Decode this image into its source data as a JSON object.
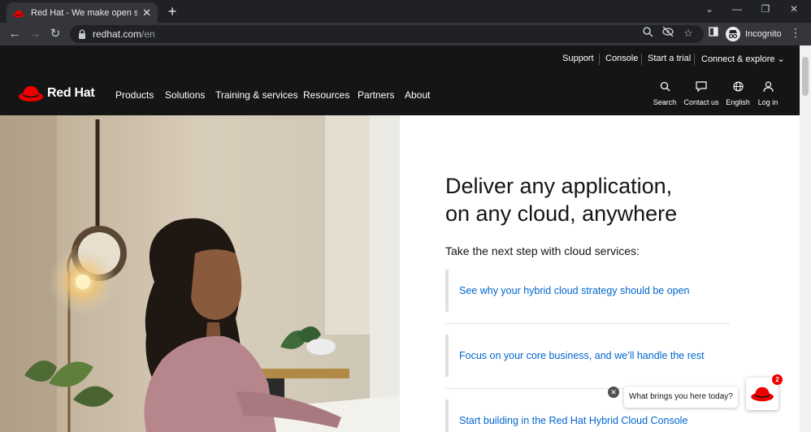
{
  "browser": {
    "tab_title": "Red Hat - We make open source",
    "tab_close": "✕",
    "new_tab": "+",
    "url_host": "redhat.com",
    "url_path": "/en",
    "profile_label": "Incognito"
  },
  "utility_nav": {
    "items": [
      "Support",
      "Console",
      "Start a trial",
      "Connect & explore ⌄"
    ]
  },
  "brand": {
    "name": "Red Hat",
    "color": "#ee0000"
  },
  "main_nav": {
    "items": [
      "Products",
      "Solutions",
      "Training & services",
      "Resources",
      "Partners",
      "About"
    ],
    "icon_items": [
      "Search",
      "Contact us",
      "English",
      "Log in"
    ]
  },
  "hero": {
    "headline_line1": "Deliver any application,",
    "headline_line2": "on any cloud, anywhere",
    "subheading": "Take the next step with cloud services:",
    "links": [
      "See why your hybrid cloud strategy should be open",
      "Focus on your core business, and we’ll handle the rest",
      "Start building in the Red Hat Hybrid Cloud Console"
    ]
  },
  "chat": {
    "prompt": "What brings you here today?",
    "badge_count": "2",
    "close_symbol": "✕"
  },
  "colors": {
    "header_bg": "#151515",
    "link": "#0066cc",
    "accent": "#ee0000"
  }
}
